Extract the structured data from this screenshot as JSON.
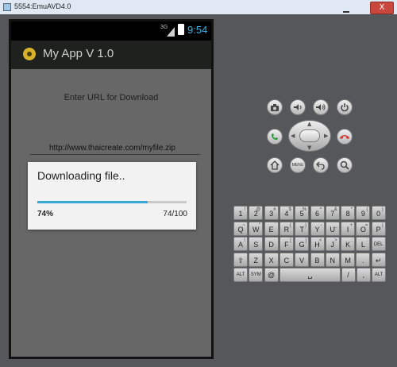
{
  "window": {
    "title": "5554:EmuAVD4.0",
    "close_label": "X"
  },
  "status_bar": {
    "network": "3G",
    "time": "9:54"
  },
  "app": {
    "title": "My App V 1.0"
  },
  "main": {
    "enter_label": "Enter URL for Download",
    "url_value": "http://www.thaicreate.com/myfile.zip"
  },
  "dialog": {
    "title": "Downloading file..",
    "percent_text": "74%",
    "count_text": "74/100",
    "progress": 74,
    "progress_max": 100
  },
  "colors": {
    "accent": "#3aa9d8",
    "time": "#39b6e8",
    "call": "#2a9a3a",
    "endcall": "#d33b3b"
  },
  "controls": {
    "top_row": [
      "camera-icon",
      "volume-down-icon",
      "volume-up-icon",
      "power-icon"
    ],
    "menu_label": "MENU"
  },
  "keyboard": {
    "rows": [
      [
        [
          "1",
          "!"
        ],
        [
          "2",
          "@"
        ],
        [
          "3",
          "#"
        ],
        [
          "4",
          "$"
        ],
        [
          "5",
          "%"
        ],
        [
          "6",
          "^"
        ],
        [
          "7",
          "&"
        ],
        [
          "8",
          "*"
        ],
        [
          "9",
          "("
        ],
        [
          "0",
          ")"
        ]
      ],
      [
        [
          "Q",
          "~"
        ],
        [
          "W",
          "\""
        ],
        [
          "E",
          "`"
        ],
        [
          "R",
          "{"
        ],
        [
          "T",
          "}"
        ],
        [
          "Y",
          "-"
        ],
        [
          "U",
          "_"
        ],
        [
          "I",
          "+"
        ],
        [
          "O",
          "="
        ],
        [
          "P",
          "|"
        ]
      ],
      [
        [
          "A",
          "\\"
        ],
        [
          "S",
          ""
        ],
        [
          "D",
          ""
        ],
        [
          "F",
          "["
        ],
        [
          "G",
          "]"
        ],
        [
          "H",
          "<"
        ],
        [
          "J",
          ">"
        ],
        [
          "K",
          ";"
        ],
        [
          "L",
          ":"
        ],
        [
          "DEL",
          ""
        ]
      ],
      [
        [
          "⇧",
          ""
        ],
        [
          "Z",
          ""
        ],
        [
          "X",
          ""
        ],
        [
          "C",
          ""
        ],
        [
          "V",
          ""
        ],
        [
          "B",
          ""
        ],
        [
          "N",
          ""
        ],
        [
          "M",
          ""
        ],
        [
          ".",
          ""
        ],
        [
          "↵",
          ""
        ]
      ]
    ],
    "bottom_row": {
      "alt": "ALT",
      "sym": "SYM",
      "at": "@",
      "space": "␣",
      "arrow": "→",
      "slash": "/",
      "question": "?",
      "comma": ",",
      "alt2": "ALT"
    }
  }
}
